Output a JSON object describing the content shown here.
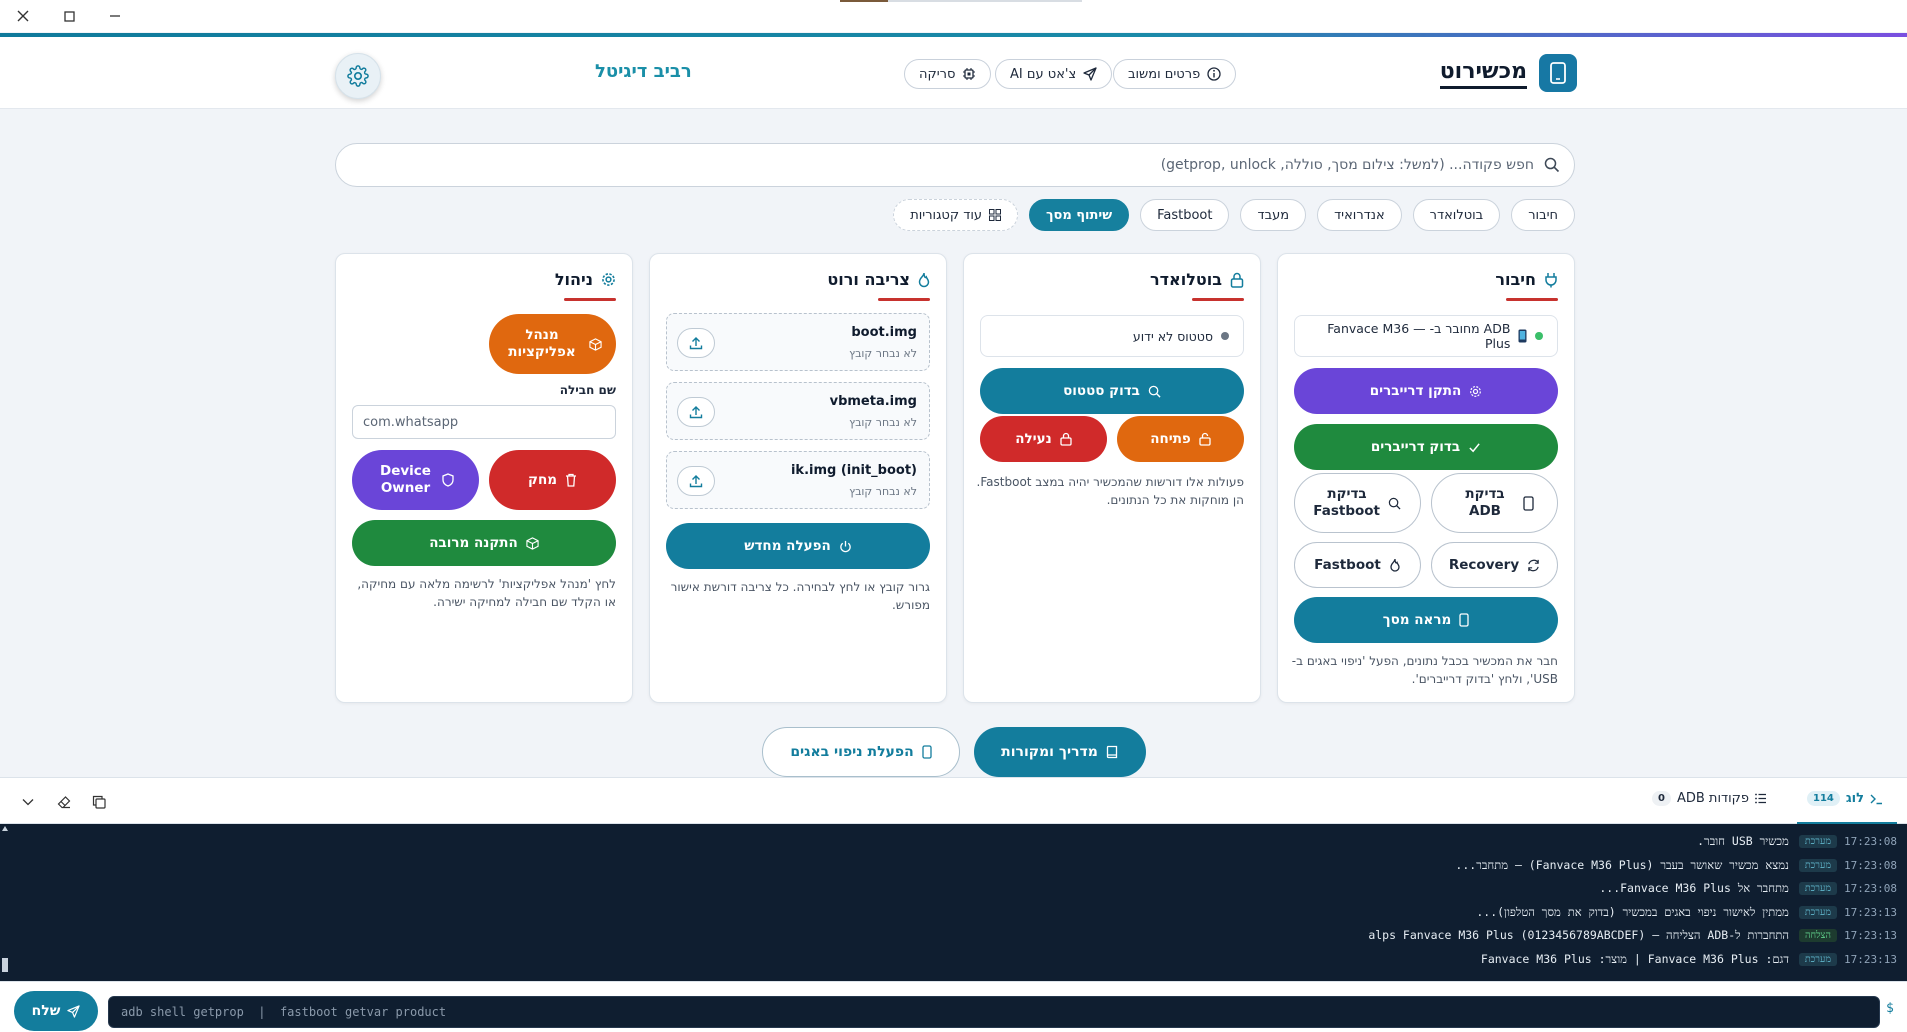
{
  "header": {
    "brand_title": "מכשירוט",
    "about_label": "פרטים ומשוב",
    "chat_label": "צ'אט עם AI",
    "scan_label": "סריקה",
    "company": "רביב דיגיטל"
  },
  "search": {
    "placeholder": "חפש פקודה... (למשל: צילום מסך, סוללה, getprop, unlock)"
  },
  "categories": [
    "חיבור",
    "בוטלואדר",
    "אנדרואיד",
    "מעבד",
    "Fastboot",
    "שיתוף מסך"
  ],
  "categories_more": "עוד קטגוריות",
  "cards": {
    "connection": {
      "title": "חיבור",
      "status": "ADB מחובר ב- — Fanvace M36 Plus",
      "install_drivers": "התקן דרייברים",
      "check_drivers": "בדוק דרייברים",
      "check_adb": "בדיקת ADB",
      "check_fastboot": "בדיקת Fastboot",
      "recovery": "Recovery",
      "fastboot": "Fastboot",
      "mirror": "מראה מסך",
      "note": "חבר את המכשיר בכבל נתונים, הפעל 'ניפוי באגים ב-USB', ולחץ 'בדוק דרייברים'."
    },
    "bootloader": {
      "title": "בוטלואדר",
      "status": "סטטוס לא ידוע",
      "check_status": "בדוק סטטוס",
      "unlock": "פתיחה",
      "lock": "נעילה",
      "note": "פעולות אלו דורשות שהמכשיר יהיה במצב Fastboot. הן מוחקות את כל הנתונים."
    },
    "flash": {
      "title": "צריבה ורוט",
      "files": [
        {
          "name": "boot.img",
          "sub": "לא נבחר קובץ"
        },
        {
          "name": "vbmeta.img",
          "sub": "לא נבחר קובץ"
        },
        {
          "name": "ik.img (init_boot)",
          "sub": "לא נבחר קובץ"
        }
      ],
      "reboot": "הפעלה מחדש",
      "note": "גרור קובץ או לחץ לבחירה. כל צריבה דורשת אישור מפורש."
    },
    "manage": {
      "title": "ניהול",
      "app_manager": "מנהל אפליקציות",
      "package_label": "שם חבילה",
      "package_value": "com.whatsapp",
      "delete": "מחק",
      "device_owner": "Device Owner",
      "bulk_install": "התקנה מרובה",
      "note": "לחץ 'מנהל אפליקציות' לרשימה מלאה עם מחיקה, או הקלד שם חבילה למחיקה ישירה."
    }
  },
  "bottom": {
    "guide": "מדריך ומקורות",
    "enable_debug": "הפעלת ניפוי באגים"
  },
  "log": {
    "tab_log": "לוג",
    "tab_log_count": "114",
    "tab_adb": "פקודות ADB",
    "tab_adb_count": "0",
    "rows": [
      {
        "time": "17:23:08",
        "tag": "מערכת",
        "text": "מכשיר USB חובר."
      },
      {
        "time": "17:23:08",
        "tag": "מערכת",
        "text": "נמצא מכשיר שאושר בעבר (Fanvace M36 Plus) — מתחבר..."
      },
      {
        "time": "17:23:08",
        "tag": "מערכת",
        "text": "מתחבר אל Fanvace M36 Plus..."
      },
      {
        "time": "17:23:13",
        "tag": "מערכת",
        "text": "ממתין לאישור ניפוי באגים במכשיר (בדוק את מסך הטלפון)..."
      },
      {
        "time": "17:23:13",
        "tag": "הצלחה",
        "text": "התחברות ל-ADB הצליחה — alps Fanvace M36 Plus (0123456789ABCDEF)"
      },
      {
        "time": "17:23:13",
        "tag": "מערכת",
        "text": "דגם: Fanvace M36 Plus | מוצר: Fanvace M36 Plus"
      }
    ]
  },
  "command": {
    "placeholder": "adb shell getprop  |  fastboot getvar product",
    "send": "שלח",
    "prompt": "$"
  },
  "colors": {
    "teal": "#137d9d",
    "purple": "#6a45d8",
    "green": "#1f8a3e",
    "orange": "#e0680f",
    "red": "#d02a2a"
  }
}
